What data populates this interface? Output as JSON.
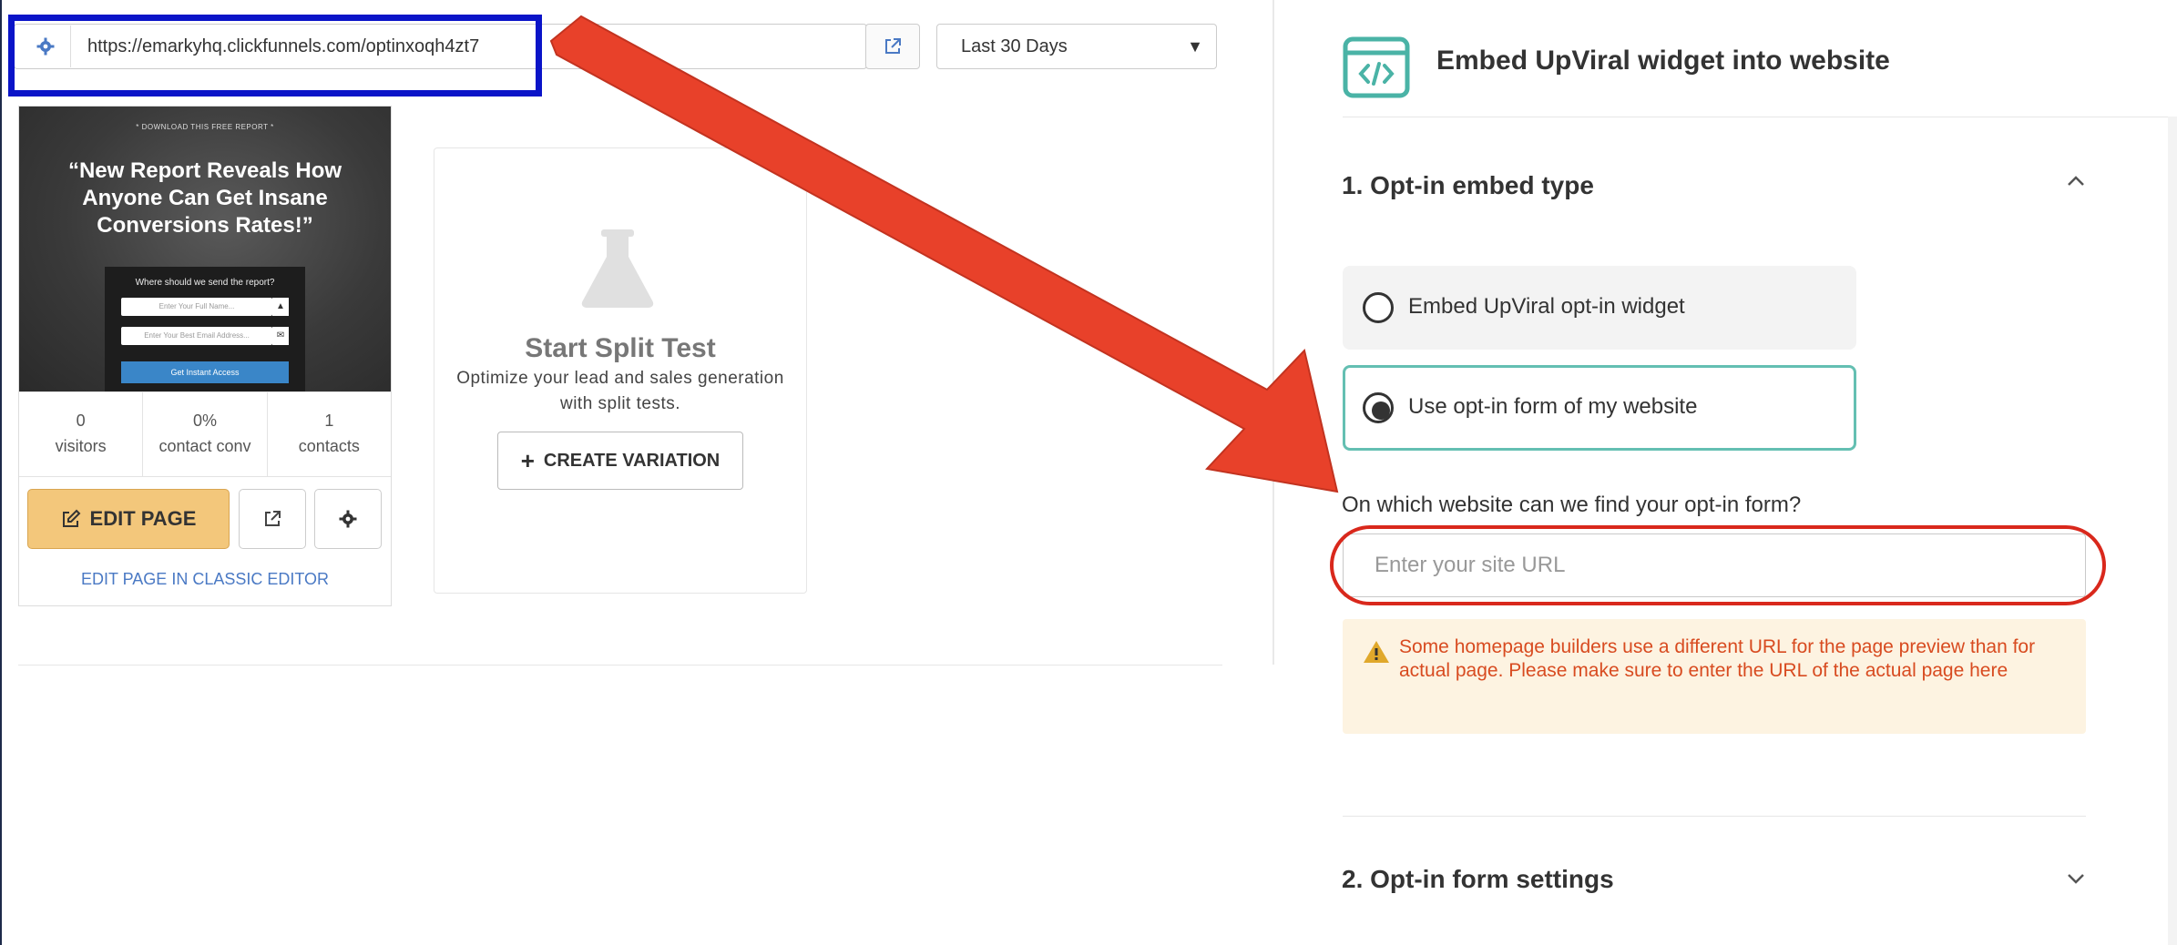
{
  "toolbar": {
    "url": "https://emarkyhq.clickfunnels.com/optinxoqh4zt7",
    "date_range": "Last 30 Days",
    "icons": {
      "settings": "gear-icon",
      "open_external": "external-link-icon",
      "dropdown": "caret-down-icon"
    }
  },
  "preview": {
    "eyebrow": "* DOWNLOAD THIS FREE REPORT *",
    "headline": "“New Report Reveals How Anyone Can Get Insane Conversions Rates!”",
    "form_question": "Where should we send the report?",
    "name_placeholder": "Enter Your Full Name...",
    "email_placeholder": "Enter Your Best Email Address...",
    "button_label": "Get Instant Access"
  },
  "stats": [
    {
      "value": "0",
      "label": "visitors"
    },
    {
      "value": "0%",
      "label": "contact conv"
    },
    {
      "value": "1",
      "label": "contacts"
    }
  ],
  "actions": {
    "edit_page": "EDIT PAGE",
    "classic_editor": "EDIT PAGE IN CLASSIC EDITOR"
  },
  "split_test": {
    "title": "Start Split Test",
    "description": "Optimize your lead and sales generation with split tests.",
    "create_label": "CREATE VARIATION"
  },
  "embed": {
    "title": "Embed UpViral widget into website",
    "section1_title": "1. Opt-in embed type",
    "option_widget": "Embed UpViral opt-in widget",
    "option_own_form": "Use opt-in form of my website",
    "selected_option": "Use opt-in form of my website",
    "site_question": "On which website can we find your opt-in form?",
    "site_placeholder": "Enter your site URL",
    "warning": "Some homepage builders use a different URL for the page preview than for actual page. Please make sure to enter the URL of the actual page here",
    "section2_title": "2. Opt-in form settings"
  },
  "colors": {
    "annotation_box": "#0a14c8",
    "annotation_arrow": "#e8412a",
    "annotation_circle": "#d9281c",
    "accent_teal": "#64bfb2",
    "edit_button": "#f3c77b",
    "warning_bg": "#fdf3e1",
    "warning_text": "#d84b20",
    "link_blue": "#4a79c4"
  }
}
